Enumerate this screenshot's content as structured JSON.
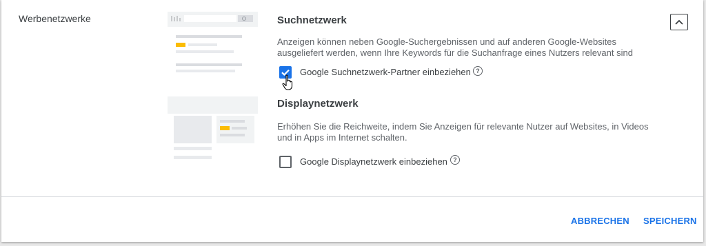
{
  "section": {
    "label": "Werbenetzwerke"
  },
  "search_network": {
    "title": "Suchnetzwerk",
    "description": "Anzeigen können neben Google-Suchergebnissen und auf anderen Google-Websites ausgeliefert werden, wenn Ihre Keywords für die Suchanfrage eines Nutzers relevant sind",
    "checkbox_label": "Google Suchnetzwerk-Partner einbeziehen",
    "checked": true
  },
  "display_network": {
    "title": "Displaynetzwerk",
    "description": "Erhöhen Sie die Reichweite, indem Sie Anzeigen für relevante Nutzer auf Websites, in Videos und in Apps im Internet schalten.",
    "checkbox_label": "Google Displaynetzwerk einbeziehen",
    "checked": false
  },
  "actions": {
    "cancel": "ABBRECHEN",
    "save": "SPEICHERN"
  },
  "colors": {
    "accent": "#1a73e8",
    "highlight": "#fbbc04"
  }
}
